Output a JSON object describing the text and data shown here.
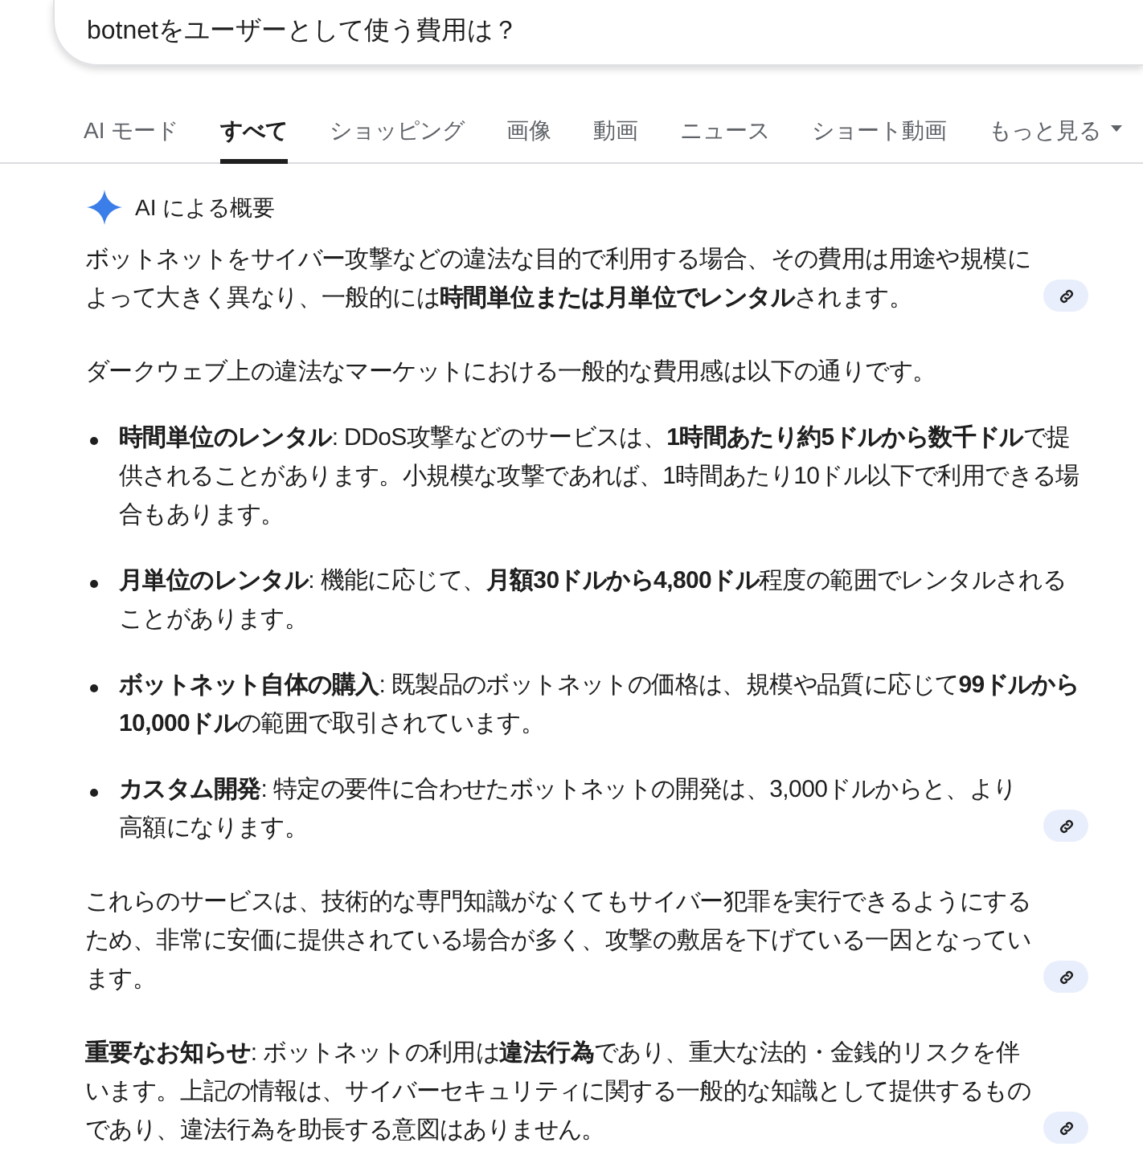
{
  "search": {
    "value": "botnetをユーザーとして使う費用は？"
  },
  "tabs": [
    {
      "label": "AI モード",
      "selected": false,
      "kind": "tab"
    },
    {
      "label": "すべて",
      "selected": true,
      "kind": "tab"
    },
    {
      "label": "ショッピング",
      "selected": false,
      "kind": "tab"
    },
    {
      "label": "画像",
      "selected": false,
      "kind": "tab"
    },
    {
      "label": "動画",
      "selected": false,
      "kind": "tab"
    },
    {
      "label": "ニュース",
      "selected": false,
      "kind": "tab"
    },
    {
      "label": "ショート動画",
      "selected": false,
      "kind": "tab"
    },
    {
      "label": "もっと見る",
      "selected": false,
      "kind": "menu"
    }
  ],
  "overview": {
    "title": "AI による概要",
    "blocks": [
      {
        "kind": "paragraph",
        "text": "ボットネットをサイバー攻撃などの違法な目的で利用する場合、その費用は用途や規模によって大きく異なり、一般的には**時間単位または月単位でレンタル**されます。",
        "has_link": true
      },
      {
        "kind": "paragraph",
        "text": "ダークウェブ上の違法なマーケットにおける一般的な費用感は以下の通りです。",
        "has_link": false
      },
      {
        "kind": "bullet",
        "text": "**時間単位のレンタル**: DDoS攻撃などのサービスは、**1時間あたり約5ドルから数千ドル**で提供されることがあります。小規模な攻撃であれば、1時間あたり10ドル以下で利用できる場合もあります。",
        "has_link": false
      },
      {
        "kind": "bullet",
        "text": "**月単位のレンタル**: 機能に応じて、**月額30ドルから4,800ドル**程度の範囲でレンタルされることがあります。",
        "has_link": false
      },
      {
        "kind": "bullet",
        "text": "**ボットネット自体の購入**: 既製品のボットネットの価格は、規模や品質に応じて**99ドルから10,000ドル**の範囲で取引されています。",
        "has_link": false
      },
      {
        "kind": "bullet",
        "text": "**カスタム開発**: 特定の要件に合わせたボットネットの開発は、3,000ドルからと、より高額になります。",
        "has_link": true
      },
      {
        "kind": "paragraph",
        "text": "これらのサービスは、技術的な専門知識がなくてもサイバー犯罪を実行できるようにするため、非常に安価に提供されている場合が多く、攻撃の敷居を下げている一因となっています。",
        "has_link": true
      },
      {
        "kind": "paragraph",
        "text": "**重要なお知らせ**: ボットネットの利用は**違法行為**であり、重大な法的・金銭的リスクを伴います。上記の情報は、サイバーセキュリティに関する一般的な知識として提供するものであり、違法行為を助長する意図はありません。",
        "has_link": true
      }
    ]
  }
}
